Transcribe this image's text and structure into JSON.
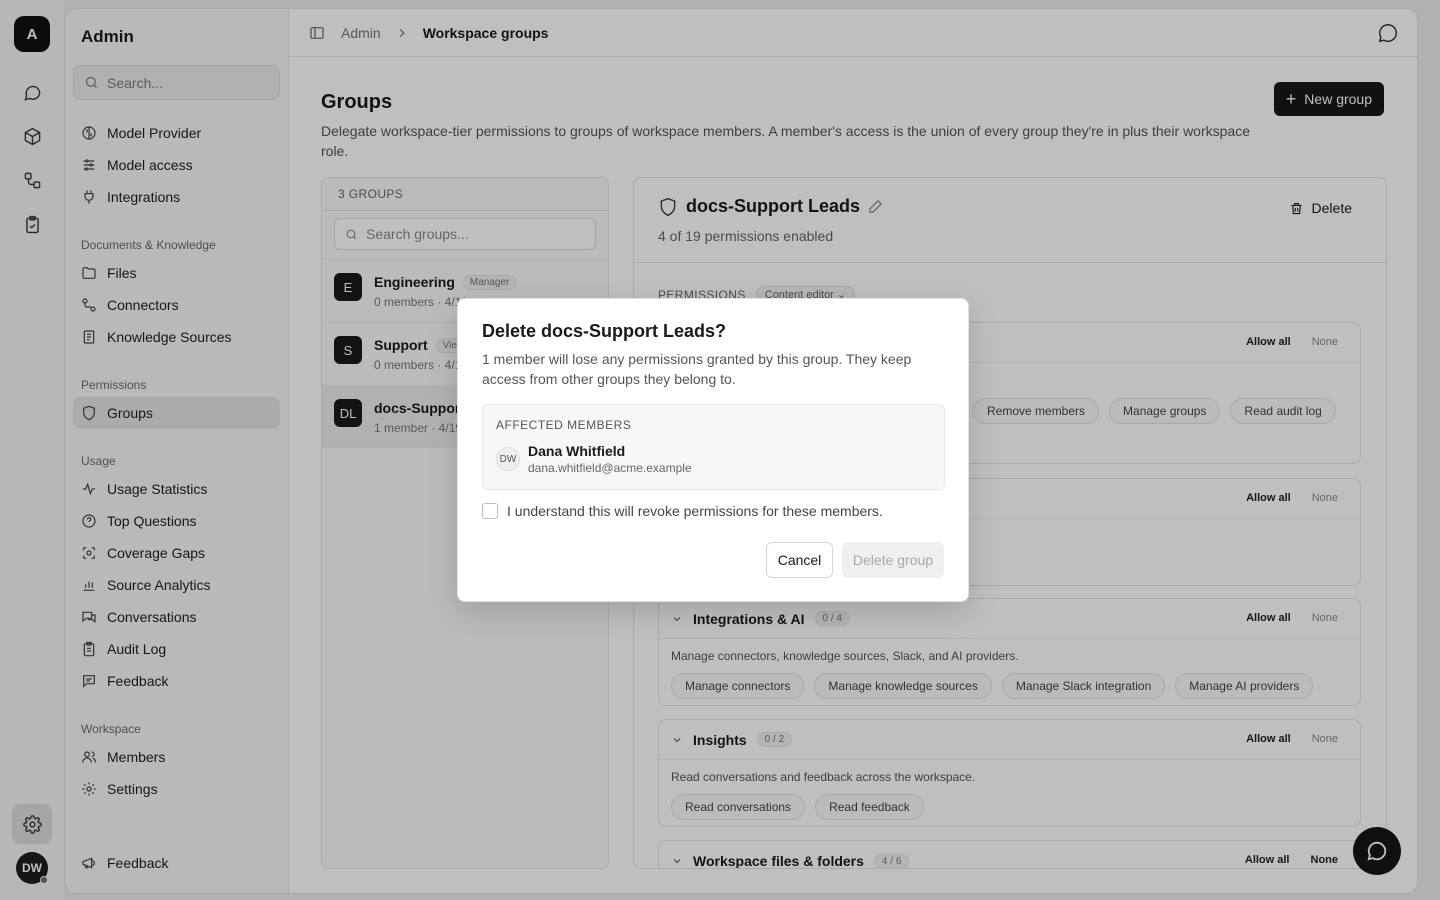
{
  "rail": {
    "logo_letter": "A",
    "avatar_initials": "DW",
    "icons": [
      "chat-icon",
      "cube-icon",
      "workflow-icon",
      "clipboard-check-icon",
      "gear-icon"
    ]
  },
  "sidebar": {
    "title": "Admin",
    "search_placeholder": "Search...",
    "items_top": [
      {
        "label": "Model Provider",
        "icon": "brain-icon"
      },
      {
        "label": "Model access",
        "icon": "sliders-icon"
      },
      {
        "label": "Integrations",
        "icon": "plug-icon"
      }
    ],
    "sections": {
      "documents": "Documents & Knowledge",
      "permissions": "Permissions",
      "usage": "Usage",
      "workspace": "Workspace"
    },
    "documents_items": [
      {
        "label": "Files",
        "icon": "folder-icon"
      },
      {
        "label": "Connectors",
        "icon": "connector-icon"
      },
      {
        "label": "Knowledge Sources",
        "icon": "book-icon"
      }
    ],
    "permissions_items": [
      {
        "label": "Groups",
        "icon": "shield-icon"
      }
    ],
    "usage_items": [
      {
        "label": "Usage Statistics",
        "icon": "activity-icon"
      },
      {
        "label": "Top Questions",
        "icon": "question-icon"
      },
      {
        "label": "Coverage Gaps",
        "icon": "scan-icon"
      },
      {
        "label": "Source Analytics",
        "icon": "bar-chart-icon"
      },
      {
        "label": "Conversations",
        "icon": "messages-icon"
      },
      {
        "label": "Audit Log",
        "icon": "clipboard-icon"
      },
      {
        "label": "Feedback",
        "icon": "message-square-icon"
      }
    ],
    "workspace_items": [
      {
        "label": "Members",
        "icon": "users-icon"
      },
      {
        "label": "Settings",
        "icon": "settings-icon"
      }
    ],
    "footer_feedback": "Feedback"
  },
  "topbar": {
    "crumb_admin": "Admin",
    "crumb_current": "Workspace groups"
  },
  "page": {
    "title": "Groups",
    "description": "Delegate workspace-tier permissions to groups of workspace members. A member's access is the union of every group they're in plus their workspace role.",
    "new_group_label": "New group"
  },
  "groups": {
    "count_label": "3 GROUPS",
    "search_placeholder": "Search groups...",
    "list": [
      {
        "avatar": "E",
        "name": "Engineering",
        "badge": "Manager",
        "meta": "0 members · 4/19"
      },
      {
        "avatar": "S",
        "name": "Support",
        "badge": "Viewer",
        "meta": "0 members · 4/19"
      },
      {
        "avatar": "DL",
        "name": "docs-Support Leads",
        "badge": "",
        "meta": "1 member · 4/19"
      }
    ]
  },
  "detail": {
    "name": "docs-Support Leads",
    "subtitle": "4 of 19 permissions enabled",
    "delete_label": "Delete",
    "permissions_label": "PERMISSIONS",
    "role_preset": "Content editor",
    "allow_all": "Allow all",
    "none": "None",
    "card1_chips": [
      "Remove members",
      "Manage groups",
      "Read audit log"
    ],
    "card_integrations": {
      "title": "Integrations & AI",
      "count": "0 / 4",
      "desc": "Manage connectors, knowledge sources, Slack, and AI providers.",
      "chips": [
        "Manage connectors",
        "Manage knowledge sources",
        "Manage Slack integration",
        "Manage AI providers"
      ]
    },
    "card_insights": {
      "title": "Insights",
      "count": "0 / 2",
      "desc": "Read conversations and feedback across the workspace.",
      "chips": [
        "Read conversations",
        "Read feedback"
      ]
    },
    "card_files": {
      "title": "Workspace files & folders",
      "count": "4 / 6"
    }
  },
  "dialog": {
    "title": "Delete docs-Support Leads?",
    "description": "1 member will lose any permissions granted by this group. They keep access from other groups they belong to.",
    "affected_label": "AFFECTED MEMBERS",
    "member_initials": "DW",
    "member_name": "Dana Whitfield",
    "member_email": "dana.whitfield@acme.example",
    "confirm_label": "I understand this will revoke permissions for these members.",
    "cancel_label": "Cancel",
    "delete_label": "Delete group"
  }
}
